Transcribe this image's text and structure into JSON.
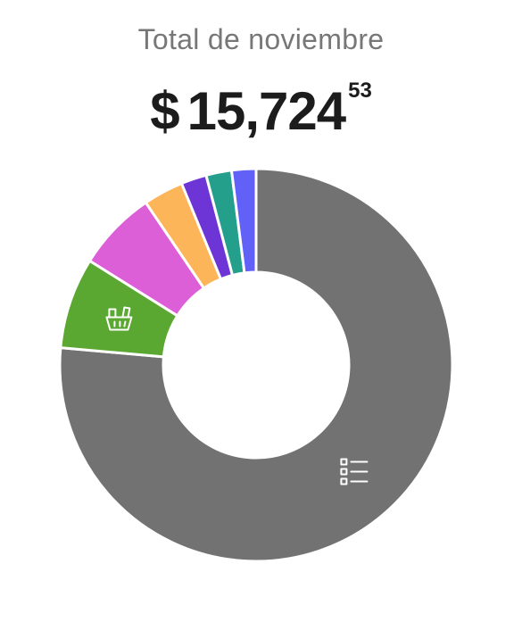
{
  "header": {
    "title": "Total de noviembre",
    "currency_symbol": "$",
    "amount_integer": "15,724",
    "amount_decimals": "53"
  },
  "chart_data": {
    "type": "pie",
    "donut": true,
    "title": "Total de noviembre",
    "total": 15724.53,
    "slices": [
      {
        "share": 0.764,
        "color": "#727272",
        "icon": "list-icon"
      },
      {
        "share": 0.075,
        "color": "#5aa831",
        "icon": "grocery-basket-icon"
      },
      {
        "share": 0.066,
        "color": "#dd5fd8",
        "icon": ""
      },
      {
        "share": 0.033,
        "color": "#fdb55a",
        "icon": ""
      },
      {
        "share": 0.021,
        "color": "#6e35d6",
        "icon": ""
      },
      {
        "share": 0.021,
        "color": "#239f8c",
        "icon": ""
      },
      {
        "share": 0.02,
        "color": "#6161f7",
        "icon": ""
      }
    ]
  }
}
